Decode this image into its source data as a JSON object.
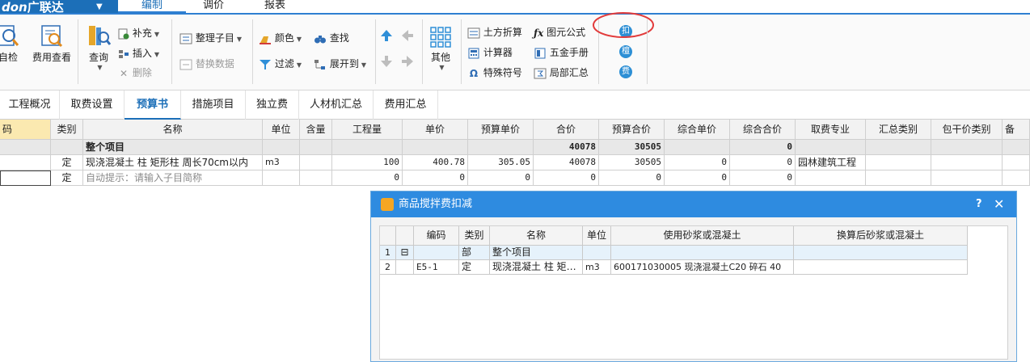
{
  "app": {
    "brand_latin": "don",
    "brand_cn": "广联达",
    "brand_caret": "▼"
  },
  "menu": [
    "编制",
    "调价",
    "报表"
  ],
  "ribbon": {
    "self_check": "自检",
    "fee_view": "费用查看",
    "query": "查询",
    "supplement": "补充",
    "insert": "插入",
    "delete": "删除",
    "arrange_sub": "整理子目",
    "replace_data": "替换数据",
    "color": "颜色",
    "find": "查找",
    "filter": "过滤",
    "expand_to": "展开到",
    "other": "其他",
    "earthwork": "土方折算",
    "formula": "图元公式",
    "calculator": "计算器",
    "hardware_manual": "五金手册",
    "special_symbol": "特殊符号",
    "partial_summary": "局部汇总",
    "circle_btns": [
      "扣",
      "檀",
      "费"
    ]
  },
  "tabs": [
    "工程概况",
    "取费设置",
    "预算书",
    "措施项目",
    "独立费",
    "人材机汇总",
    "费用汇总"
  ],
  "grid": {
    "headers": [
      "码",
      "类别",
      "名称",
      "单位",
      "含量",
      "工程量",
      "单价",
      "预算单价",
      "合价",
      "预算合价",
      "综合单价",
      "综合合价",
      "取费专业",
      "汇总类别",
      "包干价类别",
      "备"
    ],
    "rows": [
      [
        "",
        "",
        "整个项目",
        "",
        "",
        "",
        "",
        "",
        "40078",
        "30505",
        "",
        "0",
        "",
        "",
        "",
        ""
      ],
      [
        "",
        "定",
        "现浇混凝土 柱 矩形柱 周长70cm以内",
        "m3",
        "",
        "100",
        "400.78",
        "305.05",
        "40078",
        "30505",
        "0",
        "0",
        "园林建筑工程",
        "",
        "",
        ""
      ],
      [
        "",
        "定",
        "自动提示：请输入子目简称",
        "",
        "",
        "0",
        "0",
        "0",
        "0",
        "0",
        "0",
        "0",
        "",
        "",
        "",
        ""
      ]
    ]
  },
  "dialog": {
    "title": "商品搅拌费扣减",
    "help": "?",
    "close": "✕",
    "headers": [
      "",
      "",
      "编码",
      "类别",
      "名称",
      "单位",
      "使用砂浆或混凝土",
      "换算后砂浆或混凝土"
    ],
    "rows": [
      [
        "1",
        "⊟",
        "",
        "部",
        "整个项目",
        "",
        "",
        ""
      ],
      [
        "2",
        "",
        "E5-1",
        "定",
        "现浇混凝土 柱 矩…",
        "m3",
        "600171030005 现浇混凝土C20 碎石 40",
        ""
      ]
    ]
  },
  "colors": {
    "accent": "#1c6fb8",
    "dialog_title": "#2e8be0",
    "highlight_circle": "#e23b3b"
  }
}
